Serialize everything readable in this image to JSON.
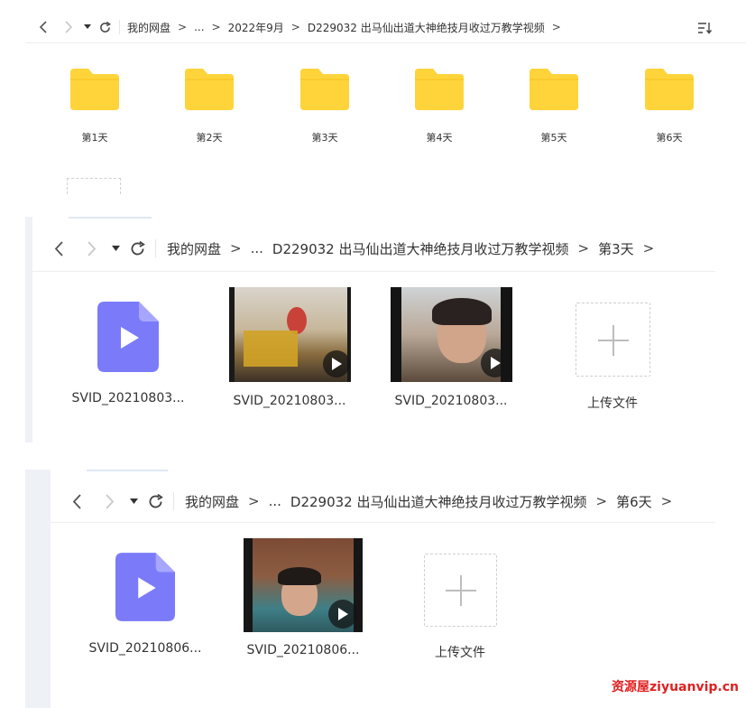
{
  "panel1": {
    "breadcrumb": [
      "我的网盘",
      "...",
      "2022年9月",
      "D229032 出马仙出道大神绝技月收过万教学视频"
    ],
    "folders": [
      "第1天",
      "第2天",
      "第3天",
      "第4天",
      "第5天",
      "第6天"
    ]
  },
  "panel2": {
    "breadcrumb": [
      "我的网盘",
      "...",
      "D229032 出马仙出道大神绝技月收过万教学视频",
      "第3天"
    ],
    "files": [
      "SVID_20210803...",
      "SVID_20210803...",
      "SVID_20210803..."
    ],
    "upload_label": "上传文件"
  },
  "panel3": {
    "breadcrumb": [
      "我的网盘",
      "...",
      "D229032 出马仙出道大神绝技月收过万教学视频",
      "第6天"
    ],
    "files": [
      "SVID_20210806...",
      "SVID_20210806..."
    ],
    "upload_label": "上传文件"
  },
  "nav": {
    "sep": ">"
  },
  "colors": {
    "folder": "#FFD43B",
    "video_icon": "#7B7BFA"
  },
  "watermark": "资源屋ziyuanvip.cn"
}
